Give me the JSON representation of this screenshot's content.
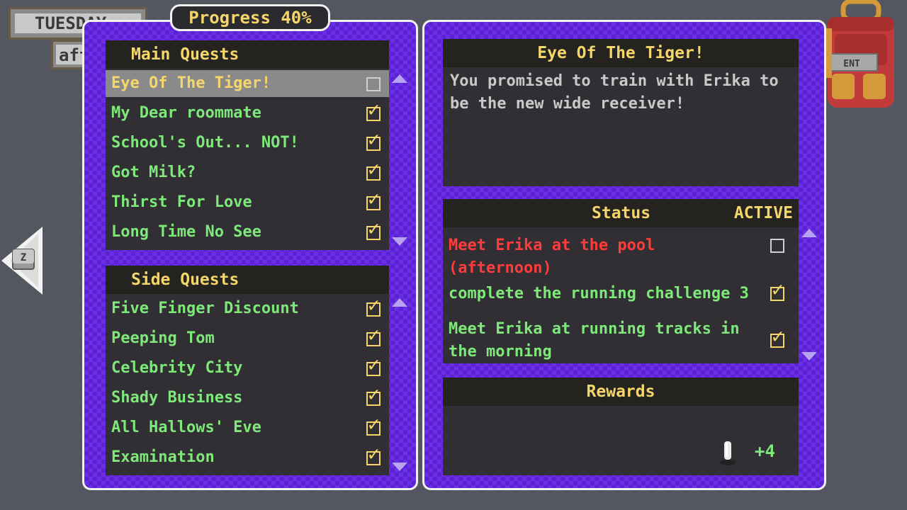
{
  "calendar": {
    "day": "TUESDAY",
    "time": "afternoon"
  },
  "progress_label": "Progress 40%",
  "main_quests": {
    "title": "Main Quests",
    "items": [
      {
        "label": "Eye Of The Tiger!",
        "done": false,
        "selected": true
      },
      {
        "label": "My Dear roommate",
        "done": true
      },
      {
        "label": "School's Out... NOT!",
        "done": true
      },
      {
        "label": "Got Milk?",
        "done": true
      },
      {
        "label": "Thirst For Love",
        "done": true
      },
      {
        "label": "Long Time No See",
        "done": true
      }
    ]
  },
  "side_quests": {
    "title": "Side Quests",
    "items": [
      {
        "label": "Five Finger Discount",
        "done": true
      },
      {
        "label": "Peeping Tom",
        "done": true
      },
      {
        "label": "Celebrity City",
        "done": true
      },
      {
        "label": "Shady Business",
        "done": true
      },
      {
        "label": "All Hallows' Eve",
        "done": true
      },
      {
        "label": "Examination",
        "done": true
      }
    ]
  },
  "detail": {
    "title": "Eye Of The Tiger!",
    "description": "You promised to train with Erika to be the new wide receiver!",
    "status_label": "Status",
    "status_value": "ACTIVE",
    "objectives": [
      {
        "label": "Meet Erika at the pool (afternoon)",
        "done": false,
        "color": "#ff3b3b"
      },
      {
        "label": "complete the running challenge 3",
        "done": true,
        "color": "#7ee87a"
      },
      {
        "label": "Meet Erika at running tracks in the morning",
        "done": true,
        "color": "#7ee87a"
      }
    ],
    "rewards_label": "Rewards",
    "reward_amount": "+4"
  },
  "backpack_label": "ENT",
  "back_key_label": "Z",
  "colors": {
    "accent_yellow": "#f5d66a",
    "quest_green": "#7ee87a",
    "objective_red": "#ff3b3b",
    "panel_purple": "#6a2ee6"
  }
}
